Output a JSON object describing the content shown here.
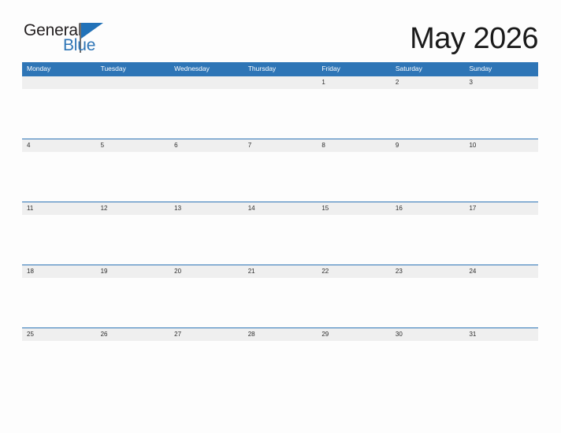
{
  "brand": {
    "name_part1": "General",
    "name_part2": "Blue",
    "logo_icon": "triangle-flag-icon",
    "accent_color": "#2e75b6"
  },
  "header": {
    "title": "May 2026",
    "month": "May",
    "year": "2026"
  },
  "calendar": {
    "header_color": "#2e75b6",
    "date_band_color": "#efefef",
    "weekdays": [
      "Monday",
      "Tuesday",
      "Wednesday",
      "Thursday",
      "Friday",
      "Saturday",
      "Sunday"
    ],
    "weeks": [
      {
        "days": [
          "",
          "",
          "",
          "",
          "1",
          "2",
          "3"
        ]
      },
      {
        "days": [
          "4",
          "5",
          "6",
          "7",
          "8",
          "9",
          "10"
        ]
      },
      {
        "days": [
          "11",
          "12",
          "13",
          "14",
          "15",
          "16",
          "17"
        ]
      },
      {
        "days": [
          "18",
          "19",
          "20",
          "21",
          "22",
          "23",
          "24"
        ]
      },
      {
        "days": [
          "25",
          "26",
          "27",
          "28",
          "29",
          "30",
          "31"
        ]
      }
    ]
  }
}
